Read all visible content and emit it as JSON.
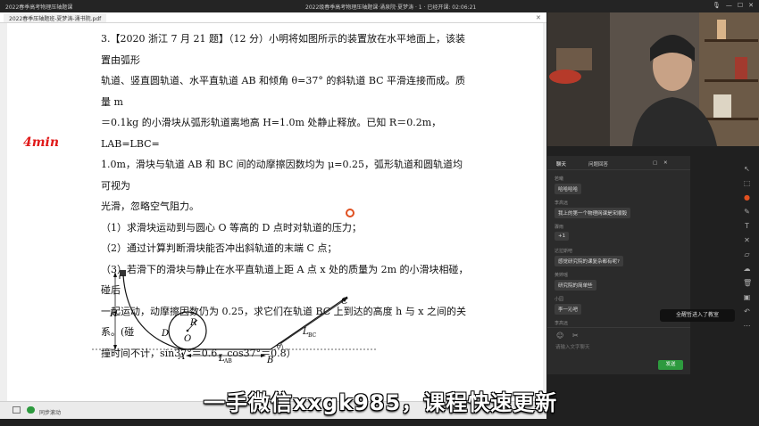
{
  "titlebar": {
    "app_title": "2022春季高考物理压轴题课",
    "meeting": "2022级春季高考物理压轴题课·涌泉院·夏梦涛 · 1 · 已经开课: 02:06:21"
  },
  "tab": {
    "label": "2022春季压轴题班-夏梦涛-涌书院.pdf"
  },
  "question": {
    "line1": "3.【2020 浙江 7 月 21 题】（12 分）小明将如图所示的装置放在水平地面上，该装置由弧形",
    "line2": "轨道、竖直圆轨道、水平直轨道 AB 和倾角 θ=37° 的斜轨道 BC 平滑连接而成。质量 m",
    "line3": "＝0.1kg 的小滑块从弧形轨道离地高 H=1.0m 处静止释放。已知 R＝0.2m，LAB=LBC=",
    "line4": "1.0m，滑块与轨道 AB 和 BC 间的动摩擦因数均为 μ=0.25，弧形轨道和圆轨道均可视为",
    "line5": "光滑，忽略空气阻力。",
    "q1": "（1）求滑块运动到与圆心 O 等高的 D 点时对轨道的压力；",
    "q2": "（2）通过计算判断滑块能否冲出斜轨道的末端 C 点；",
    "q3a": "（3）若滑下的滑块与静止在水平直轨道上距 A 点 x 处的质量为 2m 的小滑块相碰，碰后",
    "q3b": "一起运动，动摩擦因数仍为 0.25，求它们在轨道 BC 上到达的高度 h 与 x 之间的关系。(碰",
    "q3c": "撞时间不计，sin37°＝0.6，cos37°＝0.8）"
  },
  "annotation": "4min",
  "diagram": {
    "H": "H",
    "R": "R",
    "D": "D",
    "O": "O",
    "A": "A",
    "B": "B",
    "C": "C",
    "LAB": "L",
    "LAB_sub": "AB",
    "LBC": "L",
    "LBC_sub": "BC",
    "theta": "θ"
  },
  "bottombar": {
    "sync_label": "同步滚动"
  },
  "subtitle": "一手微信xxgk985，课程快速更新",
  "chat": {
    "tab1": "聊天",
    "tab2": "问题回答",
    "messages": [
      {
        "who": "若曦",
        "text": "哈哈哈哈"
      },
      {
        "who": "李高远",
        "text": "我上的第一个物理网课是宋顺毅"
      },
      {
        "who": "骤雨",
        "text": "+1"
      },
      {
        "who": "达拉斯吧",
        "text": "感觉研究院的课复杂都有呢?"
      },
      {
        "who": "黄婷瑶",
        "text": "研究院的简单些"
      },
      {
        "who": "小园",
        "text": "李一沁吧"
      },
      {
        "who": "李高远",
        "text": "袁腾飞的同样也可点人买元青者"
      }
    ],
    "input_placeholder": "请输入文字聊天",
    "send_label": "发送"
  },
  "toast": "全醒哲进入了教室"
}
